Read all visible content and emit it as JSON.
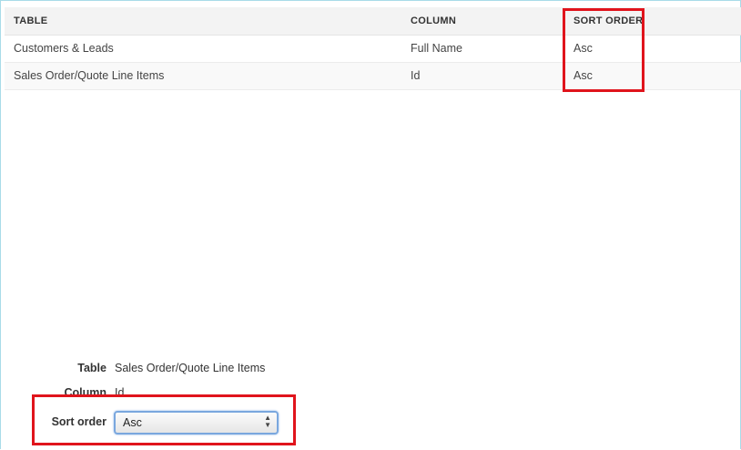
{
  "grid": {
    "headers": {
      "table": "TABLE",
      "column": "COLUMN",
      "sort_order": "SORT ORDER"
    },
    "rows": [
      {
        "table": "Customers & Leads",
        "column": "Full Name",
        "sort_order": "Asc"
      },
      {
        "table": "Sales Order/Quote Line Items",
        "column": "Id",
        "sort_order": "Asc"
      }
    ]
  },
  "form": {
    "table_label": "Table",
    "table_value": "Sales Order/Quote Line Items",
    "column_label": "Column",
    "column_value": "Id",
    "sort_order_label": "Sort order",
    "sort_order_selected": "Asc"
  },
  "colors": {
    "highlight": "#e0141c",
    "header_bg": "#f3f3f3",
    "frame_border": "#a9dbe8",
    "select_focus": "#7aa7de"
  },
  "icons": {
    "select_arrows": "updown-chevron-icon"
  }
}
